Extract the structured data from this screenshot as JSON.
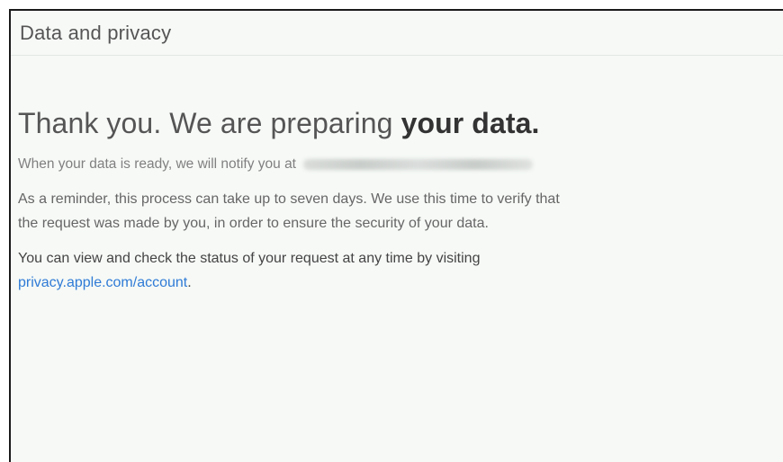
{
  "header": {
    "title": "Data and privacy"
  },
  "main": {
    "headline_part1": "Thank you. We are preparing ",
    "headline_part2": "your data.",
    "notify_text": "When your data is ready, we will notify you at",
    "reminder_line1": "As a reminder, this process can take up to seven days. We use this time to verify that",
    "reminder_line2": "the request was made by you, in order to ensure the security of your data.",
    "status_text": "You can view and check the status of your request at any time by visiting",
    "status_link": "privacy.apple.com/account",
    "status_suffix": "."
  },
  "colors": {
    "link": "#2f7bd6",
    "background": "#f6f9f6"
  }
}
